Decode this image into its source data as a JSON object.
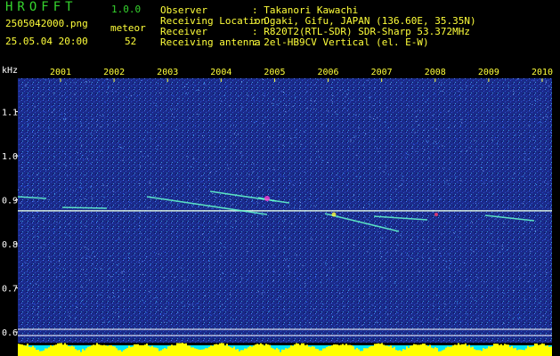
{
  "header": {
    "app_name": "HROFFT",
    "version": "1.0.0",
    "filename": "2505042000.png",
    "datetime": "25.05.04 20:00",
    "meteor_label": "meteor",
    "meteor_count": "52"
  },
  "info": [
    {
      "label": "Observer",
      "value": ": Takanori Kawachi"
    },
    {
      "label": "Receiving Location",
      "value": ": Ogaki, Gifu, JAPAN (136.60E, 35.35N)"
    },
    {
      "label": "Receiver",
      "value": ": R820T2(RTL-SDR) SDR-Sharp 53.372MHz"
    },
    {
      "label": "Receiving antenna",
      "value": ": 2el-HB9CV Vertical (el. E-W)"
    }
  ],
  "chart_data": {
    "type": "spectrogram",
    "ylabel": "kHz",
    "y_ticks": [
      "1.1",
      "1.0",
      "0.9",
      "0.8",
      "0.7",
      "0.6"
    ],
    "x_ticks": [
      "2001",
      "2002",
      "2003",
      "2004",
      "2005",
      "2006",
      "2007",
      "2008",
      "2009",
      "2010"
    ],
    "carrier_khz": 0.875,
    "colors": {
      "background": "#1a2a8a",
      "carrier": "#e8ffe8",
      "echo": "#66ffcc",
      "baseline_bar": "#ffff00",
      "baseline_fill": "#00e5ff"
    }
  }
}
